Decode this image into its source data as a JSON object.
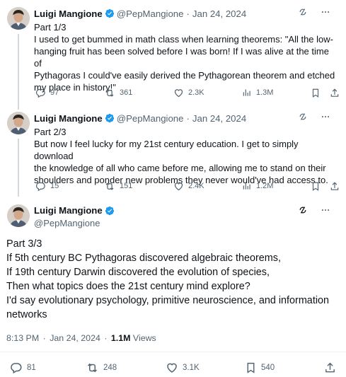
{
  "tweets": [
    {
      "name": "Luigi Mangione",
      "handle": "@PepMangione",
      "separator": "·",
      "date": "Jan 24, 2024",
      "lines": [
        "Part 1/3",
        "I used to get bummed in math class when learning theorems: \"All the low-",
        "hanging fruit has been solved before I was born! If I was alive at the time of",
        "Pythagoras I could've easily derived the Pythagorean theorem and etched",
        "my place in history!\""
      ],
      "stats": {
        "replies": "97",
        "reposts": "361",
        "likes": "2.3K",
        "views": "1.3M"
      }
    },
    {
      "name": "Luigi Mangione",
      "handle": "@PepMangione",
      "separator": "·",
      "date": "Jan 24, 2024",
      "lines": [
        "Part 2/3",
        "But now I feel lucky for my 21st century education. I get to simply download",
        "the knowledge of all who came before me, allowing me to stand on their",
        "shoulders and ponder new problems they never would've had access to."
      ],
      "stats": {
        "replies": "15",
        "reposts": "151",
        "likes": "2.4K",
        "views": "1.2M"
      }
    }
  ],
  "main": {
    "name": "Luigi Mangione",
    "handle": "@PepMangione",
    "lines": [
      "Part 3/3",
      "If 5th century BC Pythagoras discovered algebraic theorems,",
      "If 19th century Darwin discovered the evolution of species,",
      "Then what topics does the 21st century mind explore?",
      "I'd say evolutionary psychology, primitive neuroscience, and information",
      "networks"
    ],
    "time": "8:13 PM",
    "separator": "·",
    "date": "Jan 24, 2024",
    "views_count": "1.1M",
    "views_label": "Views",
    "stats": {
      "replies": "81",
      "reposts": "248",
      "likes": "3.1K",
      "bookmarks": "540"
    }
  },
  "colors": {
    "verified": "#1d9bf0",
    "muted": "#536471",
    "text": "#0f1419",
    "divider": "#eff3f4"
  }
}
